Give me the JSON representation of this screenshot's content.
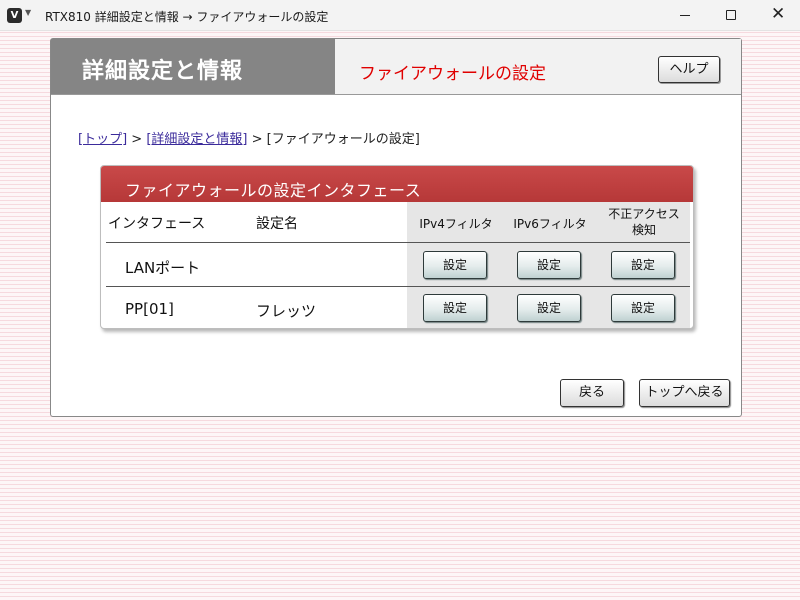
{
  "window": {
    "app_icon": "V",
    "menu_glyph": "▼",
    "title": "RTX810 詳細設定と情報 → ファイアウォールの設定",
    "minimize_glyph": "",
    "close_glyph": "✕"
  },
  "header": {
    "title": "詳細設定と情報",
    "subtitle": "ファイアウォールの設定",
    "help_label": "ヘルプ"
  },
  "breadcrumb": {
    "top": "[トップ]",
    "sep1": " > ",
    "detail": "[詳細設定と情報]",
    "sep2": " > ",
    "current": "[ファイアウォールの設定]"
  },
  "firewall": {
    "title": "ファイアウォールの設定インタフェース",
    "columns": {
      "interface": "インタフェース",
      "setting_name": "設定名",
      "ipv4": "IPv4フィルタ",
      "ipv6": "IPv6フィルタ",
      "intrusion_line1": "不正アクセス",
      "intrusion_line2": "検知"
    },
    "rows": [
      {
        "interface": "LANポート",
        "name": "",
        "ipv4": "設定",
        "ipv6": "設定",
        "intrusion": "設定"
      },
      {
        "interface": "PP[01]",
        "name": "フレッツ",
        "ipv4": "設定",
        "ipv6": "設定",
        "intrusion": "設定"
      }
    ]
  },
  "footer": {
    "back_label": "戻る",
    "top_label": "トップへ戻る"
  },
  "colors": {
    "accent_red": "#c94949",
    "subtitle_red": "#e00000",
    "header_gray": "#858585"
  }
}
